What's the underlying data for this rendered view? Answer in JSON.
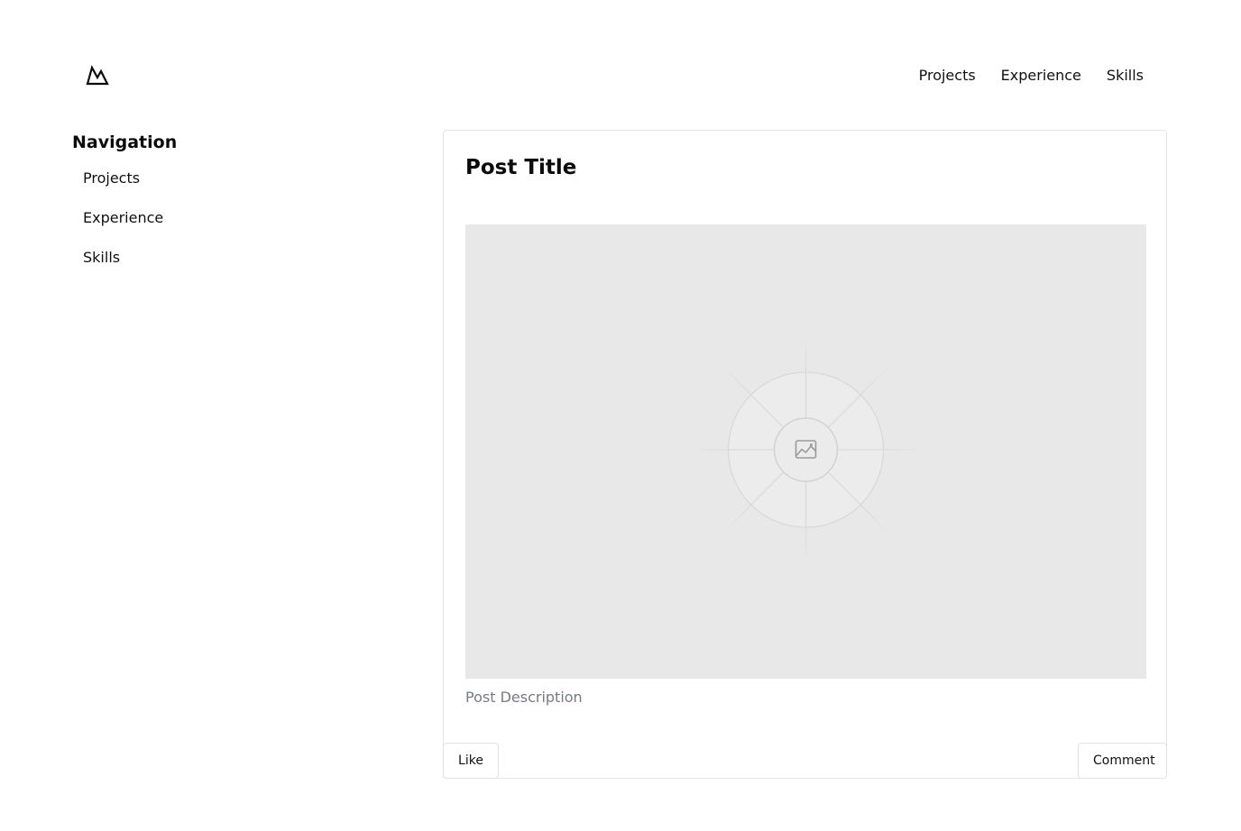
{
  "header": {
    "logo_icon": "mountain-logo-icon",
    "nav": [
      {
        "label": "Projects"
      },
      {
        "label": "Experience"
      },
      {
        "label": "Skills"
      }
    ]
  },
  "sidebar": {
    "title": "Navigation",
    "items": [
      {
        "label": "Projects"
      },
      {
        "label": "Experience"
      },
      {
        "label": "Skills"
      }
    ]
  },
  "post": {
    "title": "Post Title",
    "image_icon": "image-placeholder-icon",
    "description": "Post Description",
    "like_label": "Like",
    "comment_label": "Comment"
  },
  "colors": {
    "text": "#111111",
    "muted": "#777a80",
    "placeholder_bg": "#e8e8e8",
    "border": "#e5e5e5"
  }
}
